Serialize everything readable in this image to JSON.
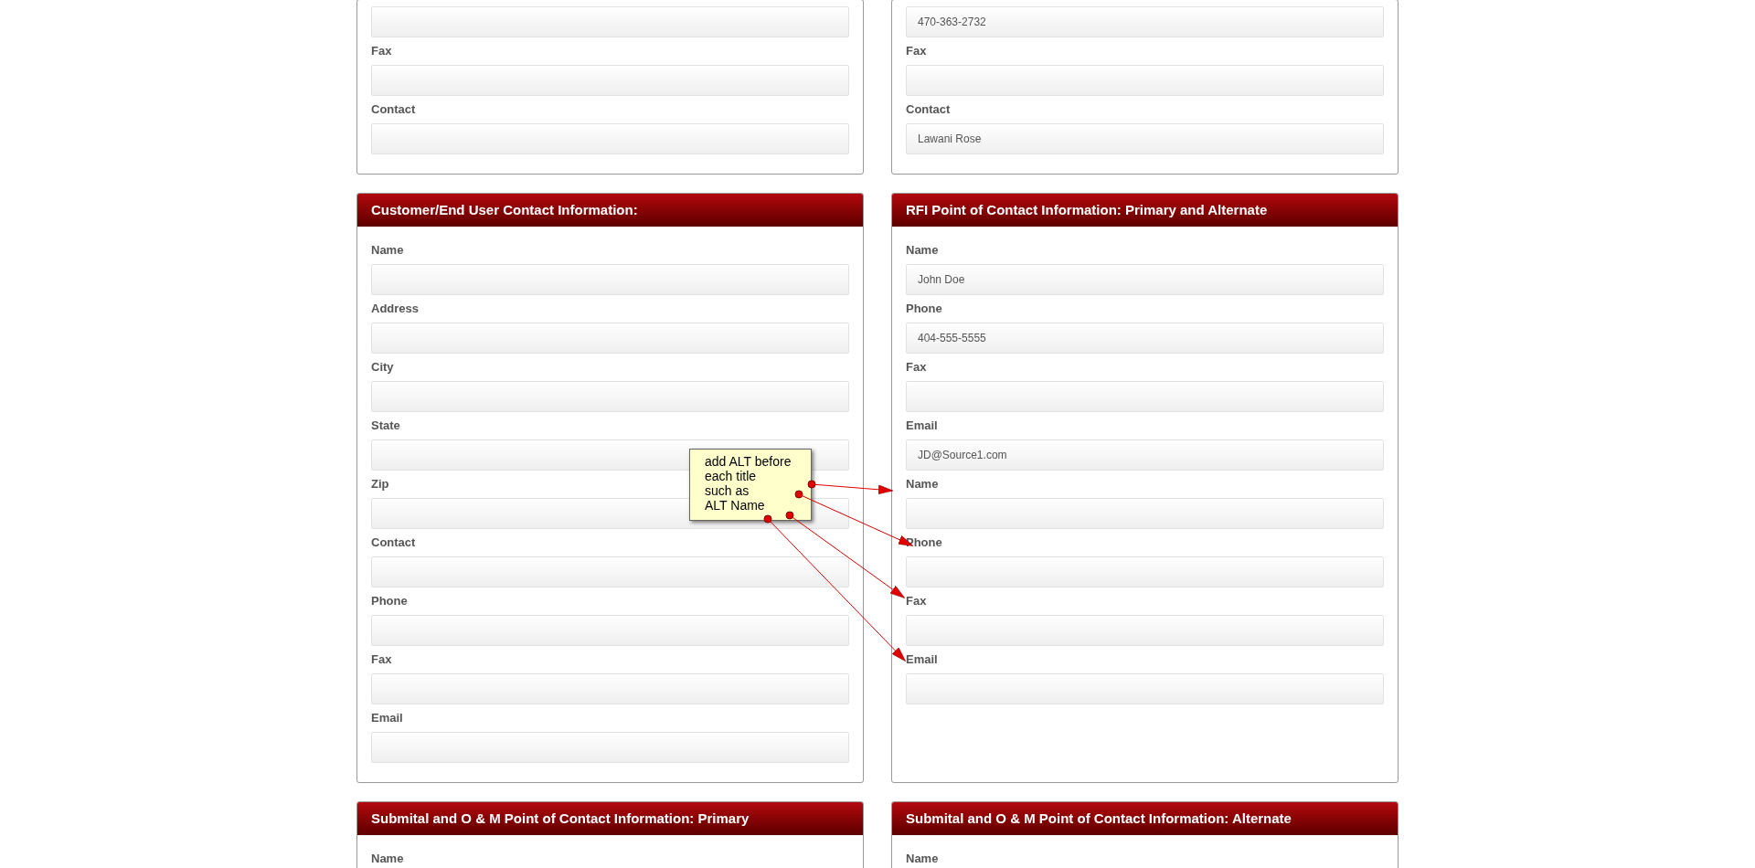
{
  "rows": [
    {
      "panels": [
        {
          "fields": [
            {
              "kind": "input"
            },
            {
              "kind": "input",
              "label": "Fax"
            },
            {
              "kind": "input",
              "label": "Contact"
            }
          ]
        },
        {
          "fields": [
            {
              "kind": "input",
              "value": "470-363-2732"
            },
            {
              "kind": "input",
              "label": "Fax"
            },
            {
              "kind": "input",
              "label": "Contact",
              "value": "Lawani Rose"
            }
          ]
        }
      ]
    },
    {
      "panels": [
        {
          "title": "Customer/End User Contact Information:",
          "fields": [
            {
              "kind": "input",
              "label": "Name"
            },
            {
              "kind": "input",
              "label": "Address"
            },
            {
              "kind": "input",
              "label": "City"
            },
            {
              "kind": "input",
              "label": "State"
            },
            {
              "kind": "input",
              "label": "Zip"
            },
            {
              "kind": "input",
              "label": "Contact"
            },
            {
              "kind": "input",
              "label": "Phone"
            },
            {
              "kind": "input",
              "label": "Fax"
            },
            {
              "kind": "input",
              "label": "Email"
            }
          ]
        },
        {
          "title": "RFI Point of Contact Information: Primary and Alternate",
          "fields": [
            {
              "kind": "input",
              "label": "Name",
              "value": "John Doe"
            },
            {
              "kind": "input",
              "label": "Phone",
              "value": "404-555-5555"
            },
            {
              "kind": "input",
              "label": "Fax"
            },
            {
              "kind": "input",
              "label": "Email",
              "value": "JD@Source1.com"
            },
            {
              "kind": "input",
              "label": "Name"
            },
            {
              "kind": "input",
              "label": "Phone"
            },
            {
              "kind": "input",
              "label": "Fax"
            },
            {
              "kind": "input",
              "label": "Email"
            }
          ]
        }
      ]
    },
    {
      "panels": [
        {
          "title": "Submital and O & M Point of Contact Information: Primary",
          "fields": [
            {
              "kind": "label",
              "label": "Name"
            }
          ]
        },
        {
          "title": "Submital and O & M Point of Contact Information: Alternate",
          "fields": [
            {
              "kind": "label",
              "label": "Name"
            }
          ]
        }
      ]
    }
  ],
  "note": {
    "lines": [
      "add ALT before",
      "each title",
      "such as",
      "ALT Name"
    ]
  }
}
